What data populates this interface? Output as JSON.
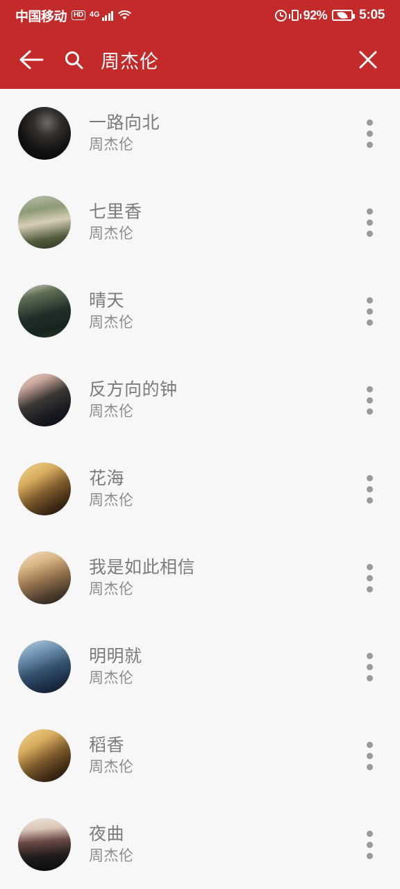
{
  "status_bar": {
    "carrier": "中国移动",
    "hd_badge": "HD",
    "network": "4G",
    "battery_percent": "92%",
    "time": "5:05",
    "icons": [
      "signal-bars-icon",
      "wifi-icon",
      "alarm-clock-icon",
      "vibrate-icon",
      "battery-saver-icon"
    ]
  },
  "app_bar": {
    "back_label": "←",
    "search_icon": "search-icon",
    "query": "周杰伦",
    "close_label": "✕",
    "background_color": "#c32a2a"
  },
  "theme": {
    "accent": "#c32a2a",
    "page_background": "#f7f7f7",
    "title_color": "#7b7b7b",
    "artist_color": "#8d8d8d",
    "kebab_color": "#9a9a9a"
  },
  "results": [
    {
      "title": "一路向北",
      "artist": "周杰伦",
      "cover": "album-cover-yilu-xiangbei",
      "menu": "more-options"
    },
    {
      "title": "七里香",
      "artist": "周杰伦",
      "cover": "album-cover-qilixiang",
      "menu": "more-options"
    },
    {
      "title": "晴天",
      "artist": "周杰伦",
      "cover": "album-cover-qingtian",
      "menu": "more-options"
    },
    {
      "title": "反方向的钟",
      "artist": "周杰伦",
      "cover": "album-cover-fanfangxiang",
      "menu": "more-options"
    },
    {
      "title": "花海",
      "artist": "周杰伦",
      "cover": "album-cover-huahai",
      "menu": "more-options"
    },
    {
      "title": "我是如此相信",
      "artist": "周杰伦",
      "cover": "album-cover-woshiruci",
      "menu": "more-options"
    },
    {
      "title": "明明就",
      "artist": "周杰伦",
      "cover": "album-cover-mingmingjiu",
      "menu": "more-options"
    },
    {
      "title": "稻香",
      "artist": "周杰伦",
      "cover": "album-cover-daoxiang",
      "menu": "more-options"
    },
    {
      "title": "夜曲",
      "artist": "周杰伦",
      "cover": "album-cover-yequ",
      "menu": "more-options"
    }
  ]
}
